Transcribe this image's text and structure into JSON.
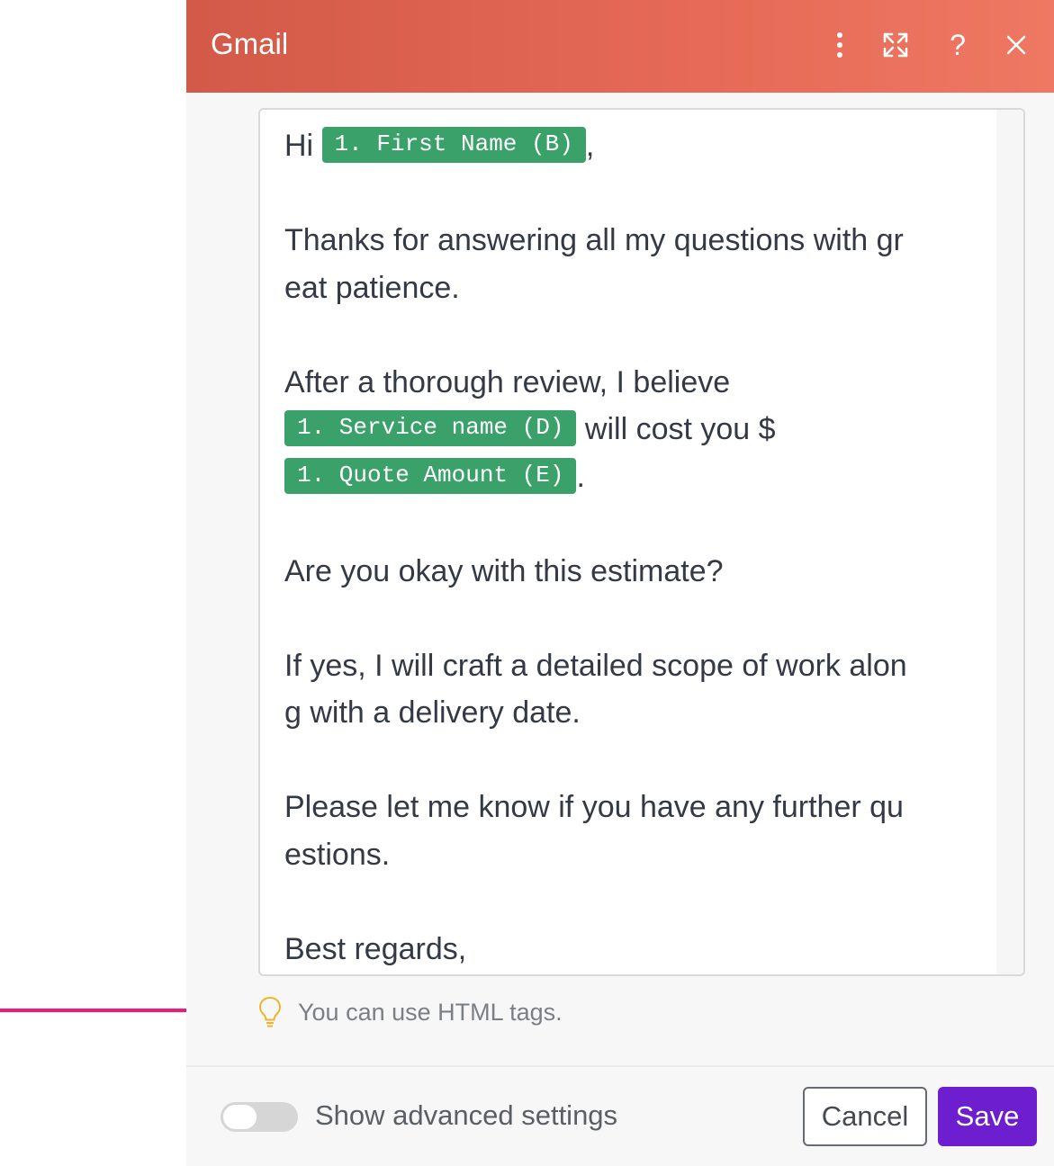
{
  "header": {
    "title": "Gmail",
    "icons": [
      "more-vertical-icon",
      "expand-icon",
      "help-icon",
      "close-icon"
    ],
    "help_glyph": "?"
  },
  "editor": {
    "greeting_prefix": "Hi",
    "first_name_token": "1. First Name (B)",
    "greeting_suffix": ",",
    "para1_line1": "Thanks for answering all my questions with gr",
    "para1_line2": "eat patience.",
    "para2_line1": "After a thorough review, I believe",
    "service_token": "1. Service name (D)",
    "para2_mid": "will cost you $",
    "quote_token": "1. Quote Amount (E)",
    "para2_end": ".",
    "para3": "Are you okay with this estimate?",
    "para4_line1": "If yes, I will craft a detailed scope of work alon",
    "para4_line2": "g with a delivery date.",
    "para5_line1": "Please let me know if you have any further qu",
    "para5_line2": "estions.",
    "closing": "Best regards,"
  },
  "hint": {
    "icon": "lightbulb-icon",
    "text": "You can use HTML tags."
  },
  "footer": {
    "advanced_toggle_label": "Show advanced settings",
    "advanced_toggle_on": false,
    "cancel_label": "Cancel",
    "save_label": "Save"
  },
  "colors": {
    "header_start": "#d35a48",
    "header_end": "#ee7863",
    "token_green": "#3aa16a",
    "save_purple": "#6d1fd0",
    "hint_bulb": "#f0b429",
    "annotation_arrow": "#f0197d"
  }
}
